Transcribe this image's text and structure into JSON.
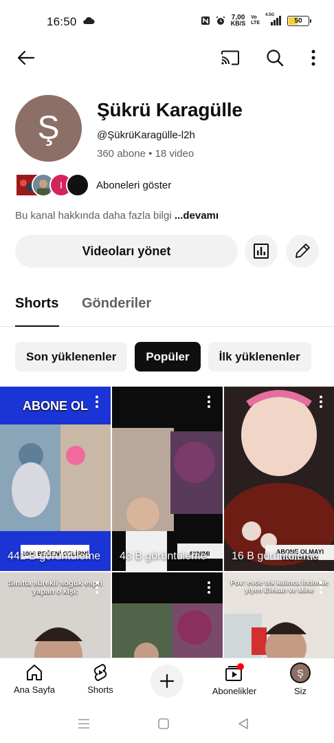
{
  "status_bar": {
    "time": "16:50",
    "network_speed_value": "7,00",
    "network_speed_unit": "KB/S",
    "volte_top": "Vo",
    "volte_bottom": "LTE",
    "signal_label": "4.5G",
    "battery_level": "50",
    "battery_fill_percent": 50,
    "battery_color": "#f3d23b"
  },
  "top_bar": {
    "icons": [
      "back-arrow-icon",
      "cast-icon",
      "search-icon",
      "more-vert-icon"
    ]
  },
  "channel": {
    "avatar_letter": "Ş",
    "avatar_color": "#8c6f66",
    "name": "Şükrü Karagülle",
    "handle": "@ŞükrüKaragülle-l2h",
    "stats": "360 abone • 18 video",
    "subscribers_link": "Aboneleri göster",
    "mini_avatar_colors": [
      "#c0392b",
      "#7a8a6a",
      "#d3245c",
      "#111111"
    ],
    "mini_avatar_letter": "I",
    "about_text": "Bu kanal hakkında daha fazla bilgi",
    "about_more": "...devamı",
    "manage_button": "Videoları yönet",
    "analytics_icon": "analytics-icon",
    "edit_icon": "pencil-icon"
  },
  "tabs": [
    {
      "label": "Shorts",
      "active": true
    },
    {
      "label": "Gönderiler",
      "active": false
    }
  ],
  "chips": [
    {
      "label": "Son yüklenenler",
      "active": false
    },
    {
      "label": "Popüler",
      "active": true
    },
    {
      "label": "İlk yüklenenler",
      "active": false
    }
  ],
  "shorts": [
    {
      "views": "441 B görüntüleme",
      "caption_top": "ABONE OL",
      "caption_bottom": "1000 BEĞENİ GELİRMİ"
    },
    {
      "views": "43 B görüntüleme",
      "caption_top": "",
      "caption_bottom": "AYNIMI"
    },
    {
      "views": "16 B görüntüleme",
      "caption_top": "",
      "caption_bottom": "ABONE OLMAYI UNUTMAYIN"
    },
    {
      "views": "",
      "caption_top": "Sınıfta sürekli soğuk espri yapan o kişi:",
      "caption_bottom": ""
    },
    {
      "views": "",
      "caption_top": "",
      "caption_bottom": ""
    },
    {
      "views": "",
      "caption_top": "Pov: evde tek kalınca İndomie yiyen Efekan ve Mine",
      "caption_bottom": ""
    }
  ],
  "bottom_nav": [
    {
      "label": "Ana Sayfa",
      "icon": "home-icon"
    },
    {
      "label": "Shorts",
      "icon": "shorts-icon"
    },
    {
      "label": "",
      "icon": "add-icon"
    },
    {
      "label": "Abonelikler",
      "icon": "subscriptions-icon"
    },
    {
      "label": "Siz",
      "icon": "profile-avatar-icon"
    }
  ],
  "system_nav": {
    "icons": [
      "recents-icon",
      "home-square-icon",
      "back-triangle-icon"
    ]
  }
}
